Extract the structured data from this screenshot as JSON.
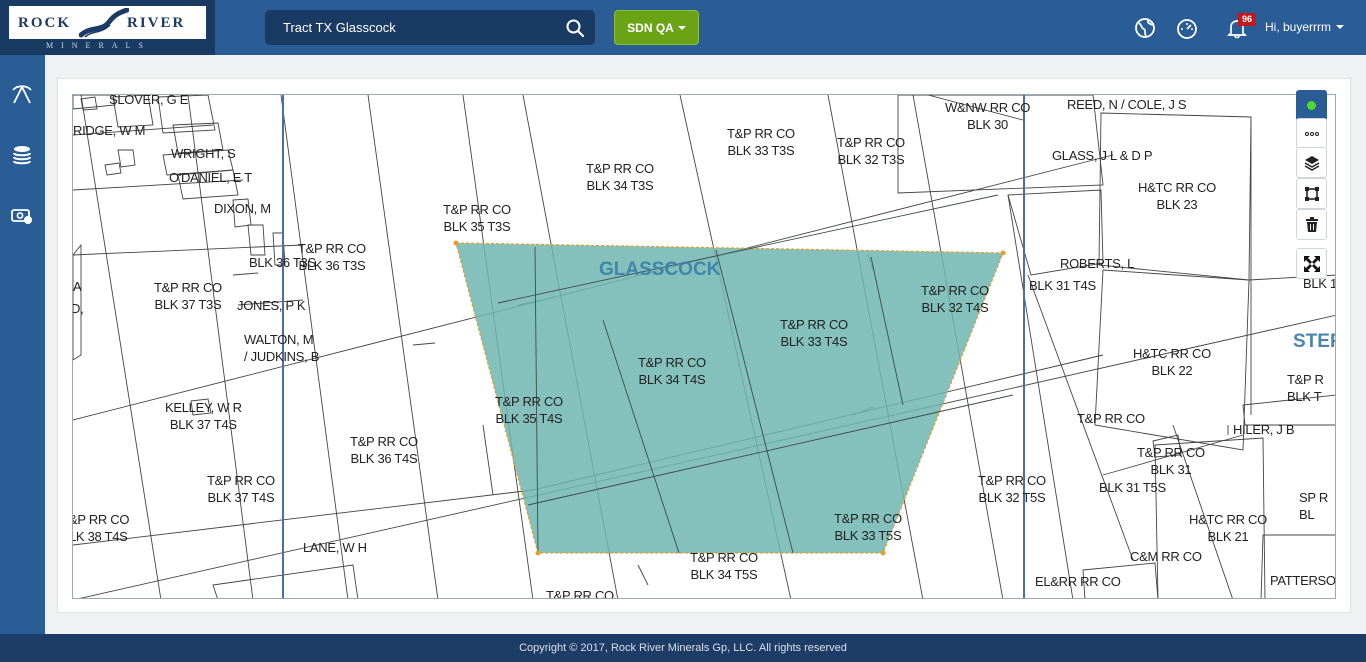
{
  "header": {
    "logo_word_left": "ROCK",
    "logo_word_right": "RIVER",
    "logo_sub": "MINERALS",
    "search_value": "Tract TX Glasscock",
    "environment_button": "SDN QA",
    "notification_count": "96",
    "greeting": "Hi, buyerrrm"
  },
  "icons": {
    "search": "search-icon",
    "globe": "globe-icon",
    "dashboard": "speedometer-icon",
    "bell": "bell-icon",
    "mining": "pickaxe-icon",
    "money": "coin-stack-icon",
    "payments": "cash-icon"
  },
  "map": {
    "county_labels": [
      "GLASSCOCK",
      "STER"
    ],
    "labels": [
      {
        "text": "SLOVER, G E"
      },
      {
        "text": "RIDGE, W M"
      },
      {
        "text": "WRIGHT, S"
      },
      {
        "text": "O'DANIEL, E T"
      },
      {
        "text": "DIXON, M"
      },
      {
        "text": "T&P RR CO\nBLK 36 T3S"
      },
      {
        "text": "BLK 36 T3S"
      },
      {
        "text": "T&P RR CO\nBLK 37 T3S"
      },
      {
        "text": "JONES, P K"
      },
      {
        "text": "WALTON, M\n/ JUDKINS, B"
      },
      {
        "text": "KELLEY, W R\nBLK 37 T4S"
      },
      {
        "text": "T&P RR CO\nBLK 36 T4S"
      },
      {
        "text": "T&P RR CO\nBLK 37 T4S"
      },
      {
        "text": "&P RR CO\nLK 38 T4S"
      },
      {
        "text": "LANE, W H"
      },
      {
        "text": "T&P RR CO\nBLK 35 T3S"
      },
      {
        "text": "T&P RR CO\nBLK 34 T3S"
      },
      {
        "text": "T&P RR CO\nBLK 33 T3S"
      },
      {
        "text": "T&P RR CO\nBLK 32 T3S"
      },
      {
        "text": "W&NW RR CO\nBLK 30"
      },
      {
        "text": "REED, N / COLE, J S"
      },
      {
        "text": "GLASS, J L & D P"
      },
      {
        "text": "H&TC RR CO\nBLK 23"
      },
      {
        "text": "ROBERTS, L"
      },
      {
        "text": "BLK 31 T4S"
      },
      {
        "text": "T&P RR CO\nBLK 32 T4S"
      },
      {
        "text": "T&P RR CO\nBLK 33 T4S"
      },
      {
        "text": "T&P RR CO\nBLK 34 T4S"
      },
      {
        "text": "T&P RR CO\nBLK 35 T4S"
      },
      {
        "text": "H&TC RR CO\nBLK 22"
      },
      {
        "text": "T&P RR CO"
      },
      {
        "text": "HILER, J B"
      },
      {
        "text": "T&P RR CO\nBLK 31"
      },
      {
        "text": "BLK 31 T5S"
      },
      {
        "text": "T&P RR CO\nBLK 32 T5S"
      },
      {
        "text": "T&P RR CO\nBLK 33 T5S"
      },
      {
        "text": "T&P RR CO\nBLK 34 T5S"
      },
      {
        "text": "T&P RR CO"
      },
      {
        "text": "H&TC RR CO\nBLK 21"
      },
      {
        "text": "C&M RR CO"
      },
      {
        "text": "EL&RR RR CO"
      },
      {
        "text": "PATTERSON"
      },
      {
        "text": "BLK 1"
      },
      {
        "text": "T&P R\nBLK T"
      },
      {
        "text": "SP R\nBL"
      },
      {
        "text": "A"
      },
      {
        "text": "D,"
      }
    ],
    "polygon_fill": "#6fb5b0",
    "polygon_stroke": "#d8a23a"
  },
  "map_tools": {
    "status": "status-dot",
    "more": "more-horizontal-icon",
    "layers": "layers-icon",
    "draw": "draw-polygon-icon",
    "delete": "trash-icon",
    "fullscreen": "fullscreen-icon"
  },
  "footer": {
    "copyright": "Copyright © 2017, Rock River Minerals Gp, LLC. All rights reserved"
  },
  "colors": {
    "header": "#2a5d96",
    "header_dark": "#193a63",
    "accent_green": "#6aa316",
    "footer": "#1d3d66"
  }
}
